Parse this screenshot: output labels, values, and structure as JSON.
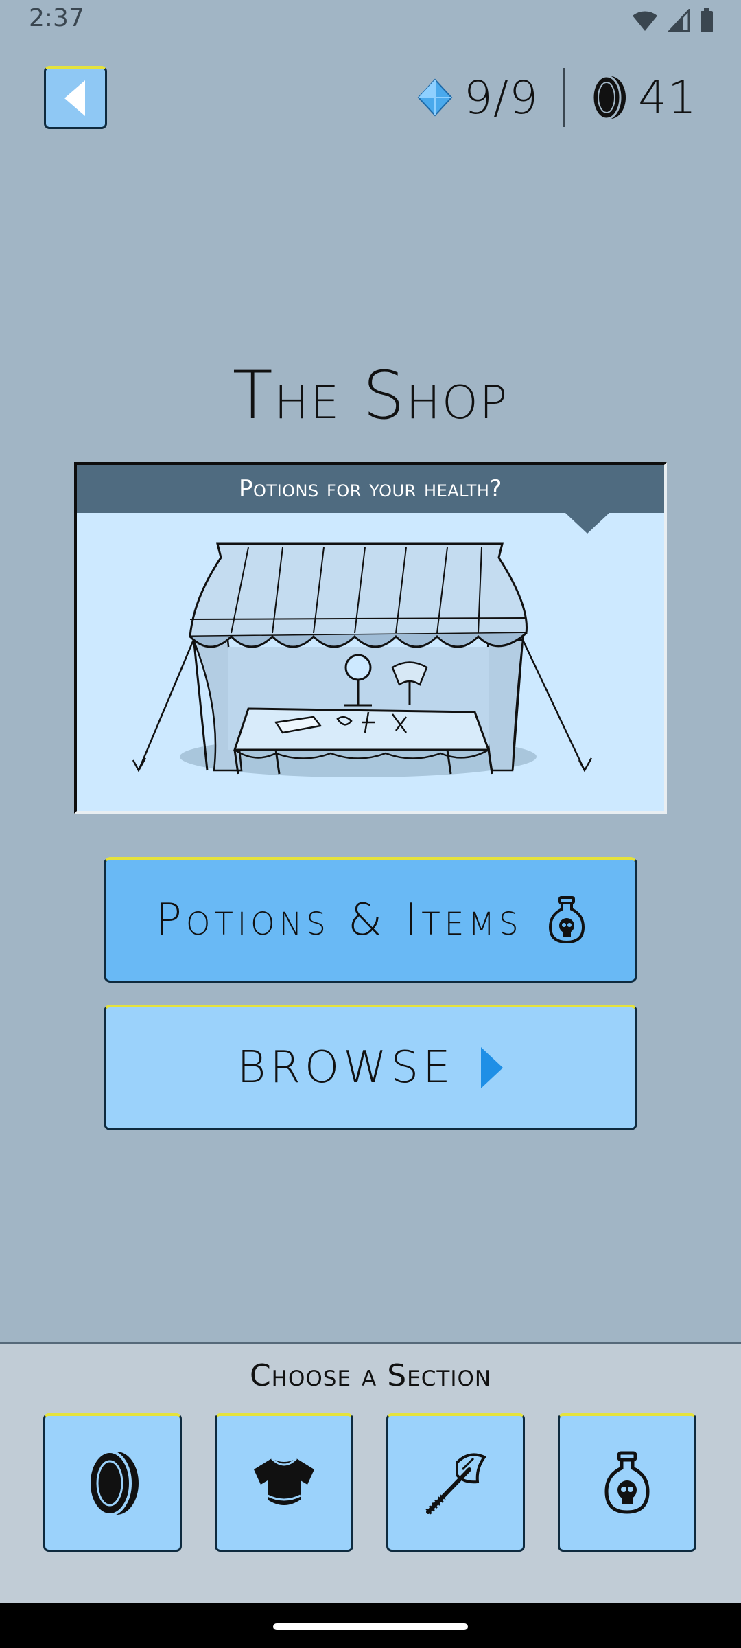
{
  "status": {
    "time": "2:37"
  },
  "header": {
    "back_icon": "back-arrow-icon",
    "gems": "9/9",
    "coins": "41",
    "gem_color": "#4aa9ec"
  },
  "page": {
    "title": "The Shop"
  },
  "shop_card": {
    "banner_text": "Potions for your health?"
  },
  "buttons": {
    "potions_label": "Potions & Items",
    "browse_label": "BROWSE",
    "browse_arrow_color": "#1e8fe6"
  },
  "sections": {
    "title": "Choose a Section",
    "tabs": [
      {
        "icon": "coin-icon"
      },
      {
        "icon": "armor-icon"
      },
      {
        "icon": "axe-icon"
      },
      {
        "icon": "potion-icon"
      }
    ]
  },
  "colors": {
    "background": "#a1b5c5",
    "button_primary": "#69b9f5",
    "button_secondary": "#9bd2fb",
    "banner": "#4f6b80",
    "panel": "#c1ccd6",
    "highlight": "#e5e23c"
  }
}
